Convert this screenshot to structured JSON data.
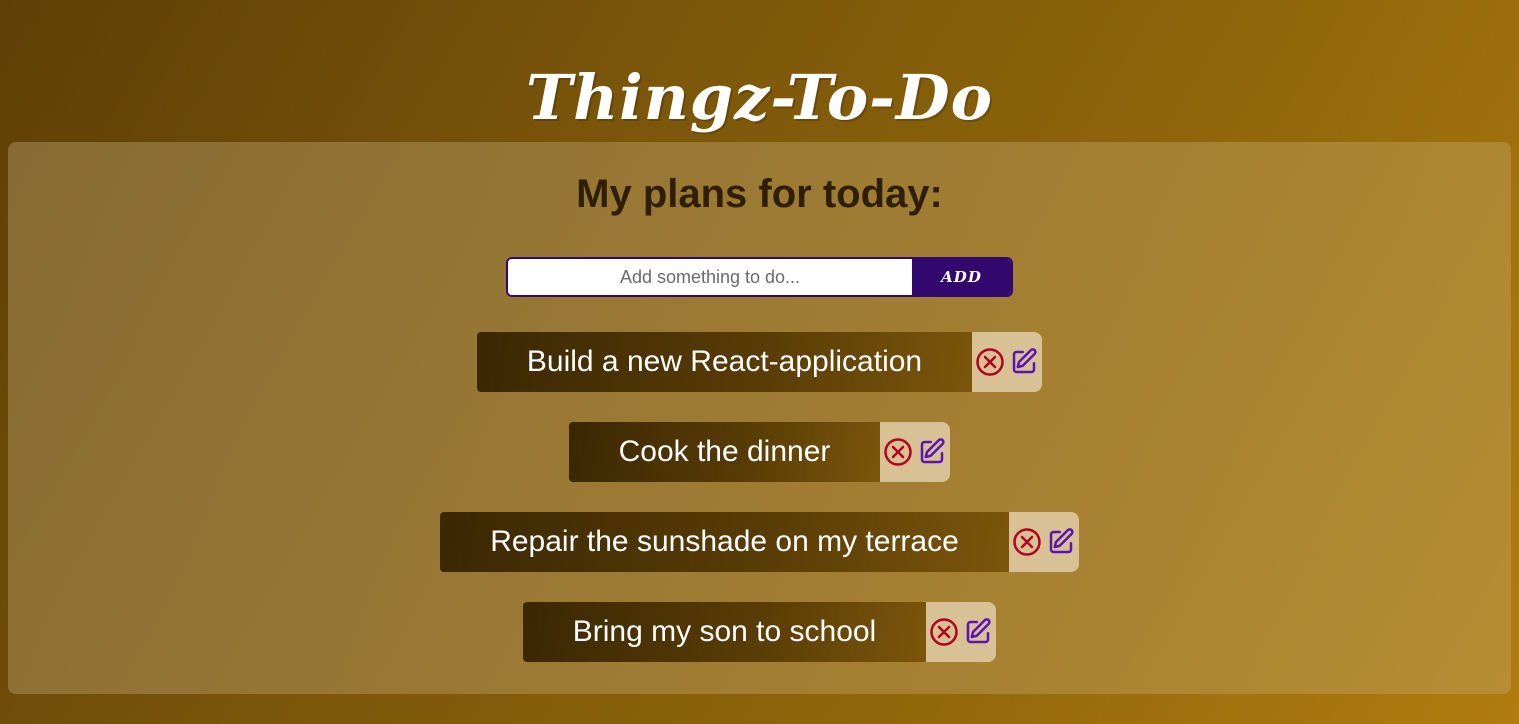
{
  "app": {
    "title": "Thingz-To-Do"
  },
  "panel": {
    "heading": "My plans for today:"
  },
  "form": {
    "input_placeholder": "Add something to do...",
    "input_value": "",
    "add_label": "ADD"
  },
  "todos": [
    {
      "text": "Build a new React-application"
    },
    {
      "text": "Cook the dinner"
    },
    {
      "text": "Repair the sunshade on my terrace"
    },
    {
      "text": "Bring my son to school"
    }
  ],
  "icons": {
    "delete": "circle-x-icon",
    "edit": "edit-pencil-icon"
  },
  "colors": {
    "accent": "#32086f",
    "delete_icon": "#b2001e",
    "edit_icon": "#5a14b4",
    "heading_text": "#2e1e02"
  }
}
